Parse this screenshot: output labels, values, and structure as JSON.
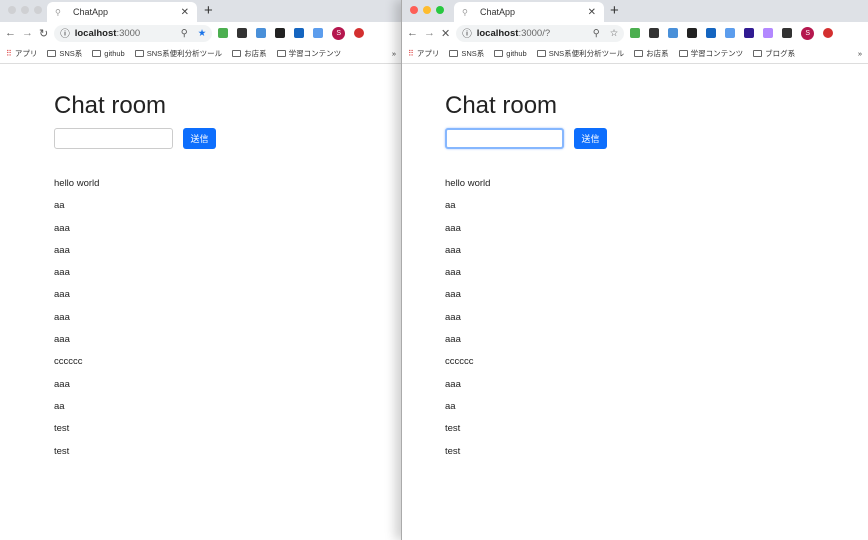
{
  "windows": [
    {
      "tab_title": "ChatApp",
      "url_host": "localhost",
      "url_rest": ":3000",
      "reload_icon": "↻"
    },
    {
      "tab_title": "ChatApp",
      "url_host": "localhost",
      "url_rest": ":3000/?",
      "reload_icon": "✕"
    }
  ],
  "avatar_letter": "S",
  "bookmarks": {
    "apps": "アプリ",
    "folders": [
      "SNS系",
      "github",
      "SNS系便利分析ツール",
      "お店系",
      "学習コンテンツ",
      "ブログ系"
    ],
    "more": "»"
  },
  "page": {
    "title": "Chat room",
    "input_value": "",
    "send_label": "送信",
    "messages": [
      "hello world",
      "aa",
      "aaa",
      "aaa",
      "aaa",
      "aaa",
      "aaa",
      "aaa",
      "cccccc",
      "aaa",
      "aa",
      "test",
      "test"
    ]
  },
  "colors": {
    "accent": "#0d6efd"
  }
}
